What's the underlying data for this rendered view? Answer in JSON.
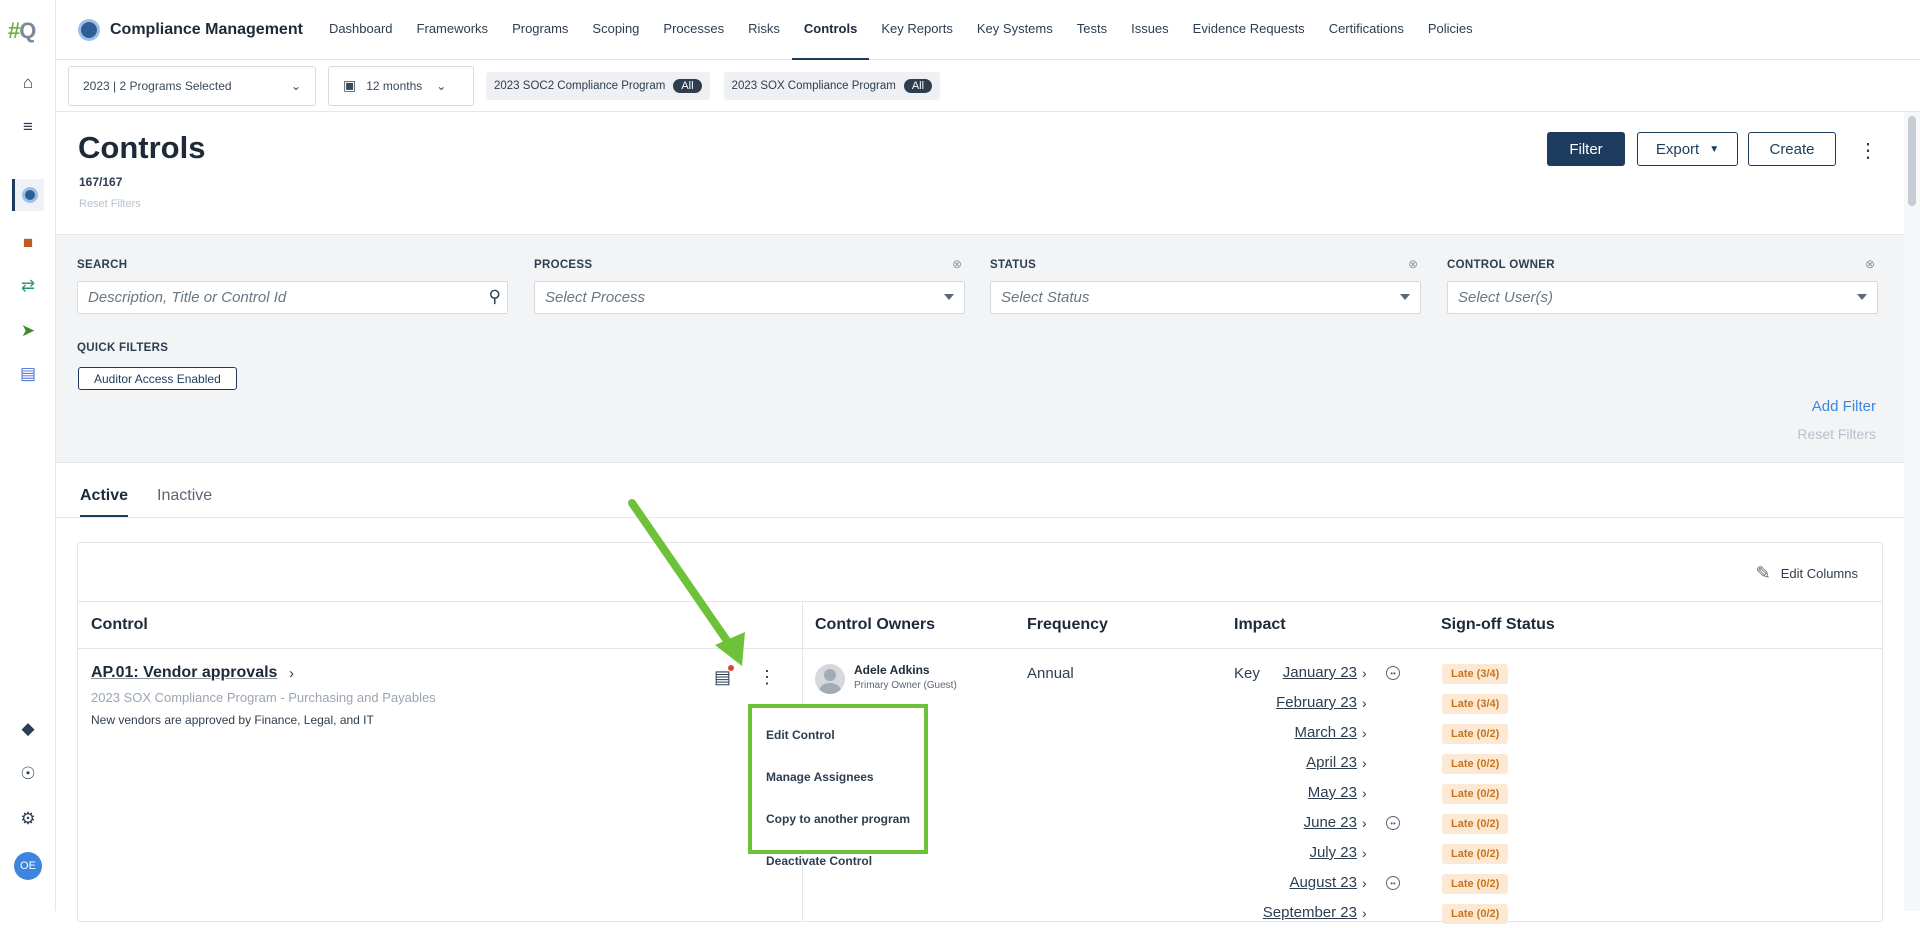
{
  "rail": {
    "logo": "#",
    "logo_tail": "Q",
    "avatar_initials": "OE",
    "icons": [
      "home-icon",
      "tasks-icon",
      "compliance-icon",
      "folder-icon",
      "sync-icon",
      "send-icon",
      "book-icon",
      "learn-icon",
      "compass-icon",
      "gear-icon"
    ]
  },
  "topnav": {
    "title": "Compliance Management",
    "links": [
      "Dashboard",
      "Frameworks",
      "Programs",
      "Scoping",
      "Processes",
      "Risks",
      "Controls",
      "Key Reports",
      "Key Systems",
      "Tests",
      "Issues",
      "Evidence Requests",
      "Certifications",
      "Policies"
    ],
    "active": "Controls"
  },
  "subbar": {
    "program_select": "2023 | 2 Programs Selected",
    "period_select": "12 months",
    "programs": [
      {
        "name": "2023 SOC2 Compliance Program",
        "badge": "All"
      },
      {
        "name": "2023 SOX Compliance Program",
        "badge": "All"
      }
    ]
  },
  "header": {
    "title": "Controls",
    "count": "167/167",
    "reset_filters": "Reset Filters",
    "filter_button": "Filter",
    "export_button": "Export",
    "create_button": "Create"
  },
  "filters": {
    "search_label": "SEARCH",
    "search_placeholder": "Description, Title or Control Id",
    "process_label": "PROCESS",
    "process_placeholder": "Select Process",
    "status_label": "STATUS",
    "status_placeholder": "Select Status",
    "owner_label": "CONTROL OWNER",
    "owner_placeholder": "Select User(s)",
    "quick_filters_label": "QUICK FILTERS",
    "quick_filter_chip": "Auditor Access Enabled",
    "add_filter": "Add Filter",
    "reset_filters": "Reset Filters"
  },
  "tabs": {
    "active": "Active",
    "inactive": "Inactive"
  },
  "table": {
    "edit_columns": "Edit Columns",
    "headers": {
      "control": "Control",
      "owners": "Control Owners",
      "frequency": "Frequency",
      "impact": "Impact",
      "signoff": "Sign-off Status"
    },
    "row": {
      "title": "AP.01: Vendor approvals",
      "program": "2023 SOX Compliance Program - Purchasing and Payables",
      "description": "New vendors are approved by Finance, Legal, and IT",
      "owner_name": "Adele Adkins",
      "owner_role": "Primary Owner (Guest)",
      "frequency": "Annual",
      "impact": "Key",
      "signoff": [
        {
          "month": "January 23",
          "status": "Late (3/4)",
          "face": true
        },
        {
          "month": "February 23",
          "status": "Late (3/4)",
          "face": false
        },
        {
          "month": "March 23",
          "status": "Late (0/2)",
          "face": false
        },
        {
          "month": "April 23",
          "status": "Late (0/2)",
          "face": false
        },
        {
          "month": "May 23",
          "status": "Late (0/2)",
          "face": false
        },
        {
          "month": "June 23",
          "status": "Late (0/2)",
          "face": true
        },
        {
          "month": "July 23",
          "status": "Late (0/2)",
          "face": false
        },
        {
          "month": "August 23",
          "status": "Late (0/2)",
          "face": true
        },
        {
          "month": "September 23",
          "status": "Late (0/2)",
          "face": false
        }
      ]
    },
    "row_menu": [
      "Edit Control",
      "Manage Assignees",
      "Copy to another program",
      "Deactivate Control"
    ]
  },
  "colors": {
    "primary": "#1d3b5c",
    "annotation_green": "#6ec23a",
    "late_badge_bg": "#fde9d3",
    "late_badge_text": "#c7741d"
  }
}
